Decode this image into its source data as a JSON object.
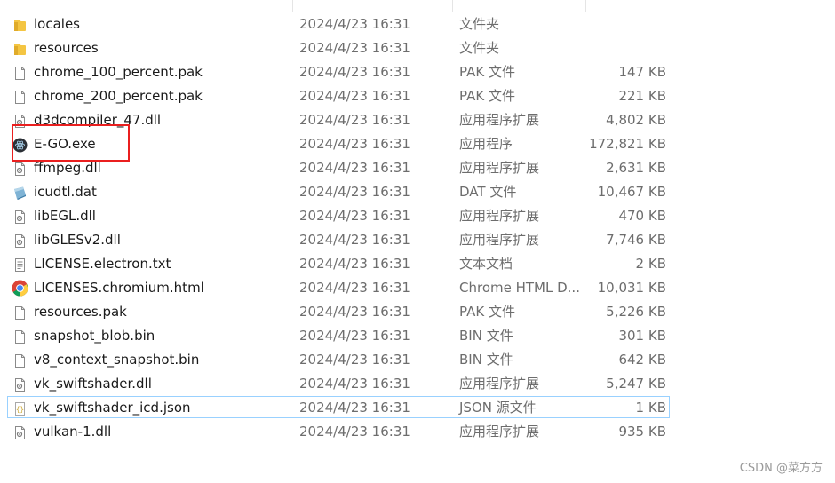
{
  "files": [
    {
      "name": "locales",
      "date": "2024/4/23 16:31",
      "type": "文件夹",
      "size": "",
      "icon": "folder-icon"
    },
    {
      "name": "resources",
      "date": "2024/4/23 16:31",
      "type": "文件夹",
      "size": "",
      "icon": "folder-icon"
    },
    {
      "name": "chrome_100_percent.pak",
      "date": "2024/4/23 16:31",
      "type": "PAK 文件",
      "size": "147 KB",
      "icon": "file-icon"
    },
    {
      "name": "chrome_200_percent.pak",
      "date": "2024/4/23 16:31",
      "type": "PAK 文件",
      "size": "221 KB",
      "icon": "file-icon"
    },
    {
      "name": "d3dcompiler_47.dll",
      "date": "2024/4/23 16:31",
      "type": "应用程序扩展",
      "size": "4,802 KB",
      "icon": "dll-icon"
    },
    {
      "name": "E-GO.exe",
      "date": "2024/4/23 16:31",
      "type": "应用程序",
      "size": "172,821 KB",
      "icon": "app-exe-icon"
    },
    {
      "name": "ffmpeg.dll",
      "date": "2024/4/23 16:31",
      "type": "应用程序扩展",
      "size": "2,631 KB",
      "icon": "dll-icon"
    },
    {
      "name": "icudtl.dat",
      "date": "2024/4/23 16:31",
      "type": "DAT 文件",
      "size": "10,467 KB",
      "icon": "dat-icon"
    },
    {
      "name": "libEGL.dll",
      "date": "2024/4/23 16:31",
      "type": "应用程序扩展",
      "size": "470 KB",
      "icon": "dll-icon"
    },
    {
      "name": "libGLESv2.dll",
      "date": "2024/4/23 16:31",
      "type": "应用程序扩展",
      "size": "7,746 KB",
      "icon": "dll-icon"
    },
    {
      "name": "LICENSE.electron.txt",
      "date": "2024/4/23 16:31",
      "type": "文本文档",
      "size": "2 KB",
      "icon": "text-file-icon"
    },
    {
      "name": "LICENSES.chromium.html",
      "date": "2024/4/23 16:31",
      "type": "Chrome HTML D...",
      "size": "10,031 KB",
      "icon": "chrome-icon"
    },
    {
      "name": "resources.pak",
      "date": "2024/4/23 16:31",
      "type": "PAK 文件",
      "size": "5,226 KB",
      "icon": "file-icon"
    },
    {
      "name": "snapshot_blob.bin",
      "date": "2024/4/23 16:31",
      "type": "BIN 文件",
      "size": "301 KB",
      "icon": "file-icon"
    },
    {
      "name": "v8_context_snapshot.bin",
      "date": "2024/4/23 16:31",
      "type": "BIN 文件",
      "size": "642 KB",
      "icon": "file-icon"
    },
    {
      "name": "vk_swiftshader.dll",
      "date": "2024/4/23 16:31",
      "type": "应用程序扩展",
      "size": "5,247 KB",
      "icon": "dll-icon"
    },
    {
      "name": "vk_swiftshader_icd.json",
      "date": "2024/4/23 16:31",
      "type": "JSON 源文件",
      "size": "1 KB",
      "icon": "json-icon",
      "selected": true
    },
    {
      "name": "vulkan-1.dll",
      "date": "2024/4/23 16:31",
      "type": "应用程序扩展",
      "size": "935 KB",
      "icon": "dll-icon"
    }
  ],
  "colors": {
    "highlight": "#ea1f1f",
    "selection": "#99d1ff",
    "folder": "#f4c542"
  },
  "watermark": "CSDN @菜方方"
}
